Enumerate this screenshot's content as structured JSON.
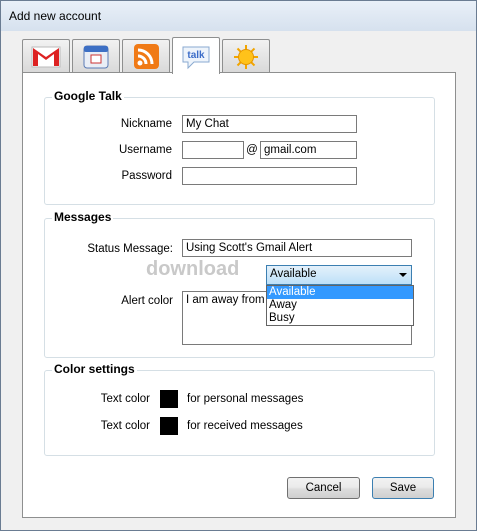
{
  "window": {
    "title": "Add new account"
  },
  "tabs": [
    {
      "icon": "gmail-icon"
    },
    {
      "icon": "calendar-icon"
    },
    {
      "icon": "rss-icon"
    },
    {
      "icon": "talk-icon",
      "active": true,
      "label": "talk"
    },
    {
      "icon": "weather-icon"
    }
  ],
  "google_talk": {
    "heading": "Google Talk",
    "nickname_label": "Nickname",
    "nickname_value": "My Chat",
    "username_label": "Username",
    "username_value": "",
    "at_sign": "@",
    "domain_value": "gmail.com",
    "password_label": "Password",
    "password_value": ""
  },
  "messages": {
    "heading": "Messages",
    "status_label": "Status Message:",
    "status_value": "Using Scott's Gmail Alert",
    "availability_selected": "Available",
    "availability_options": [
      "Available",
      "Away",
      "Busy"
    ],
    "alert_label": "Alert color",
    "alert_value": "I am away from th"
  },
  "color_settings": {
    "heading": "Color settings",
    "text_color_label_1": "Text color",
    "desc_1": "for personal messages",
    "text_color_label_2": "Text color",
    "desc_2": "for received messages",
    "swatch_color": "#000000"
  },
  "buttons": {
    "cancel": "Cancel",
    "save": "Save"
  },
  "watermark": "download"
}
